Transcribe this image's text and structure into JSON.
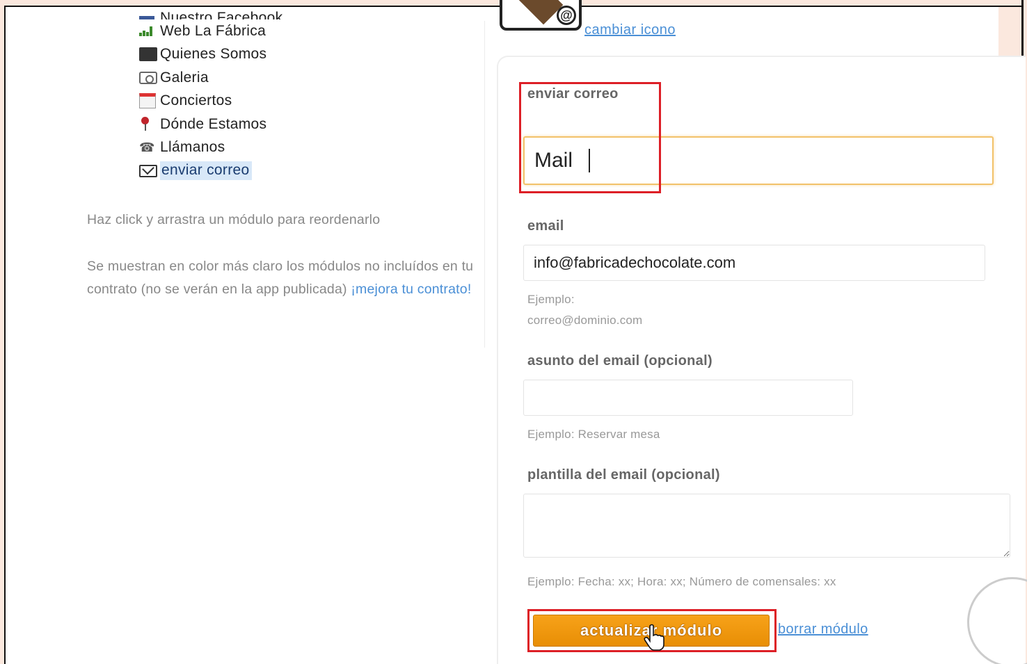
{
  "modules": [
    {
      "label": "Nuestro Facebook",
      "icon": "facebook-icon",
      "partial": true
    },
    {
      "label": "Web La Fábrica",
      "icon": "chart-icon"
    },
    {
      "label": "Quienes Somos",
      "icon": "people-icon"
    },
    {
      "label": "Galeria",
      "icon": "camera-icon"
    },
    {
      "label": "Conciertos",
      "icon": "calendar-icon"
    },
    {
      "label": "Dónde Estamos",
      "icon": "map-pin-icon"
    },
    {
      "label": "Llámanos",
      "icon": "phone-icon"
    },
    {
      "label": "enviar correo",
      "icon": "mail-icon",
      "selected": true
    }
  ],
  "help": {
    "reorder": "Haz click y arrastra un módulo para reordenarlo",
    "excluded": "Se muestran en color más claro los módulos no incluídos en tu contrato (no se verán en la app publicada)",
    "upgrade_link": "¡mejora tu contrato!"
  },
  "icon_section": {
    "change_icon_link": "cambiar icono"
  },
  "form": {
    "title_label": "enviar correo",
    "title_value": "Mail",
    "email_label": "email",
    "email_value": "info@fabricadechocolate.com",
    "email_hint_1": "Ejemplo:",
    "email_hint_2": "correo@dominio.com",
    "subject_label": "asunto del email (opcional)",
    "subject_value": "",
    "subject_hint": "Ejemplo: Reservar mesa",
    "template_label": "plantilla del email (opcional)",
    "template_value": "",
    "template_hint": "Ejemplo: Fecha: xx; Hora: xx; Número de comensales: xx",
    "update_button": "actualizar módulo",
    "delete_link": "borrar módulo"
  },
  "colors": {
    "accent_orange": "#f7a219",
    "link_blue": "#4a8fd6",
    "highlight_red": "#dd1f26",
    "page_bg": "#fbe8de"
  }
}
